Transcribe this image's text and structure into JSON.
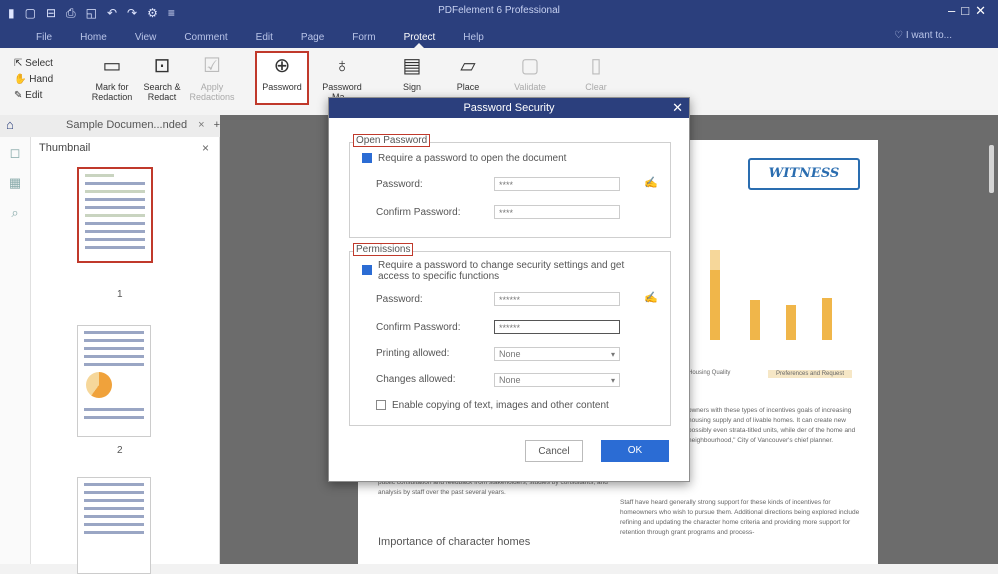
{
  "app": {
    "title": "PDFelement 6 Professional",
    "quick_access": [
      "▮",
      "▢",
      "⊟",
      "⎙",
      "◱",
      "↶",
      "↷",
      "⚙",
      "≡"
    ],
    "window_controls": "–□✕",
    "search_placeholder": "I want to..."
  },
  "menu": {
    "items": [
      "File",
      "Home",
      "View",
      "Comment",
      "Edit",
      "Page",
      "Form",
      "Protect",
      "Help"
    ],
    "active": "Protect"
  },
  "ribbon": {
    "select": "Select",
    "hand": "Hand",
    "edit": "Edit",
    "mark_for_redaction": [
      "Mark for",
      "Redaction"
    ],
    "search_redact": [
      "Search &",
      "Redact"
    ],
    "apply_redactions": [
      "Apply",
      "Redactions"
    ],
    "password": "Password",
    "password_2": [
      "Password",
      "Ma..."
    ],
    "sign": "Sign",
    "place": "Place",
    "validate": "Validate",
    "clear": "Clear"
  },
  "tabs": {
    "doc_title": "Sample Documen...nded",
    "close": "×",
    "add": "+"
  },
  "thumbnails": {
    "title": "Thumbnail",
    "close": "×",
    "pages": [
      "1",
      "2"
    ]
  },
  "document": {
    "witness_label": "WITNESS",
    "legend_1": "Housing Quality",
    "legend_2": "Preferences and Request",
    "body_left": "public consultation and feedback from stakeholders, studies by consultants, and analysis by staff over the past several years.",
    "heading": "Importance of character homes",
    "body_right_1": "owners with these types of incentives goals of increasing housing supply and of livable homes. It can create new possibly even strata-titled units, while der of the home and neighbourhood,\" City of Vancouver's chief planner.",
    "body_right_2": "Staff have heard generally strong support for these kinds of incentives for homeowners who wish to pursue them. Additional directions being explored include refining and updating the character home criteria and providing more support for retention through grant programs and process-"
  },
  "dialog": {
    "title": "Password Security",
    "close": "✕",
    "open_group_title": "Open Password",
    "open_require": "Require a password to open the document",
    "open_password_label": "Password:",
    "open_password_value": "****",
    "open_confirm_label": "Confirm Password:",
    "open_confirm_value": "****",
    "perm_group_title": "Permissions",
    "perm_require": "Require a password to change security settings and get access to specific functions",
    "perm_password_label": "Password:",
    "perm_password_value": "******",
    "perm_confirm_label": "Confirm Password:",
    "perm_confirm_value": "******",
    "printing_label": "Printing allowed:",
    "printing_value": "None",
    "changes_label": "Changes allowed:",
    "changes_value": "None",
    "copy_label": "Enable copying of text, images and other content",
    "cancel": "Cancel",
    "ok": "OK"
  },
  "colors": {
    "titlebar": "#2b3f7d",
    "accent": "#2b6cd4",
    "highlight": "#c0392b"
  }
}
